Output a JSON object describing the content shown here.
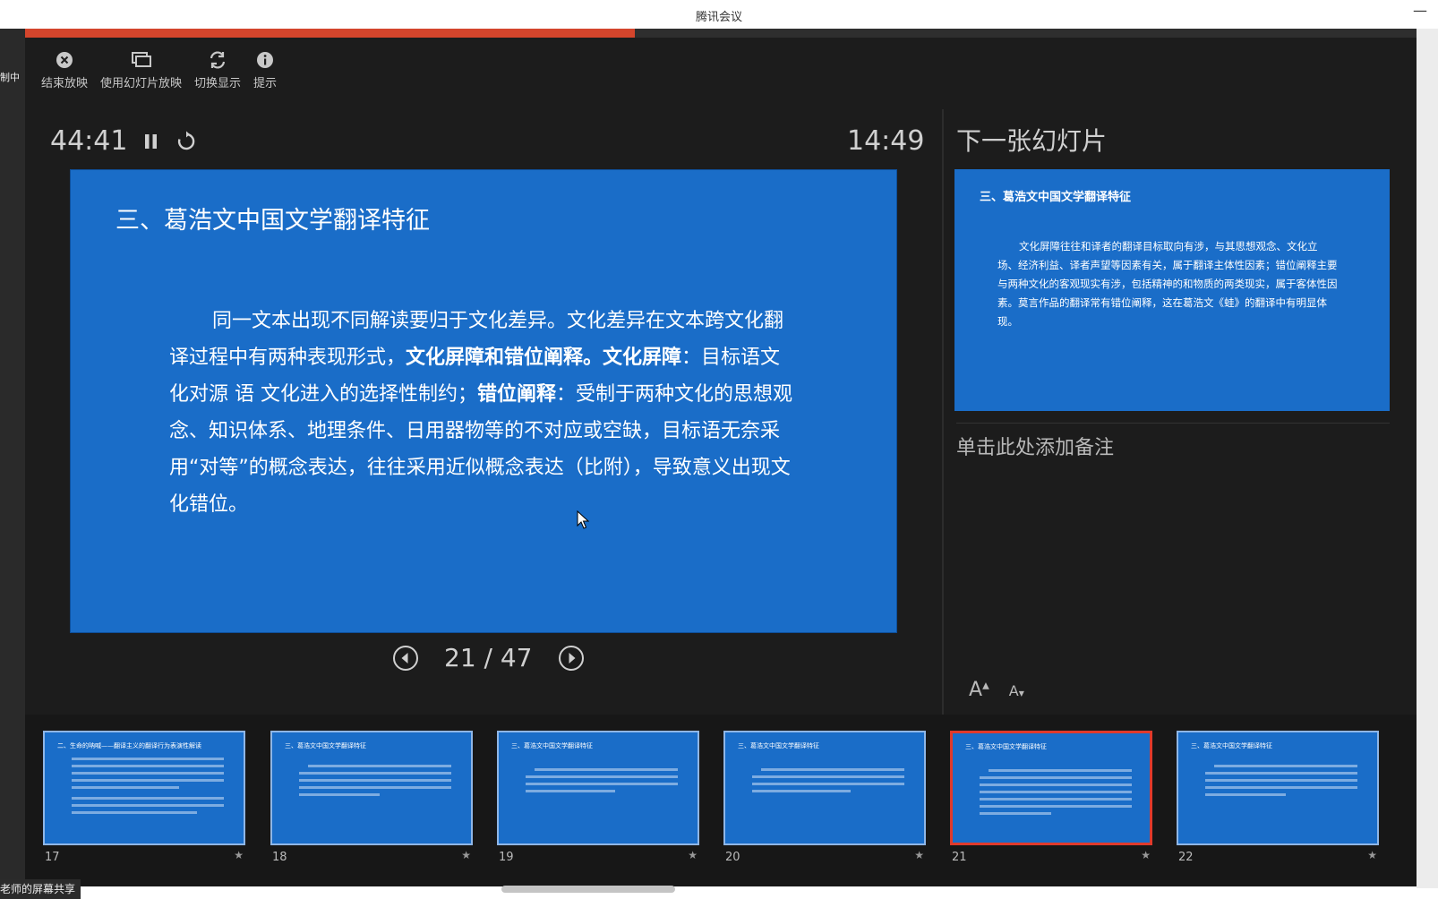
{
  "window": {
    "title": "腾讯会议",
    "minimize": "—"
  },
  "left_strip": {
    "text": "制中"
  },
  "progress": {
    "fraction": 0.438,
    "color": "#d4452c"
  },
  "toolbar": {
    "end": "结束放映",
    "use_slideshow": "使用幻灯片放映",
    "switch_display": "切换显示",
    "tips": "提示"
  },
  "timer": {
    "elapsed": "44:41",
    "clock": "14:49"
  },
  "current_slide": {
    "title": "三、葛浩文中国文学翻译特征",
    "body_a": "同一文本出现不同解读要归于文化差异。文化差异在文本跨文化翻译过程中有两种表现形式，",
    "body_b": "文化屏障和错位阐释。文化屏障",
    "body_c": "：目标语文化对源 语 文化进入的选择性制约；",
    "body_d": "错位阐释",
    "body_e": "：受制于两种文化的思想观念、知识体系、地理条件、日用器物等的不对应或空缺，目标语无奈采用“对等”的概念表达，往往采用近似概念表达（比附），导致意义出现文化错位。"
  },
  "navigation": {
    "counter": "21 / 47"
  },
  "next_slide": {
    "heading": "下一张幻灯片",
    "title": "三、葛浩文中国文学翻译特征",
    "body": "文化屏障往往和译者的翻译目标取向有涉，与其思想观念、文化立场、经济利益、译者声望等因素有关，属于翻译主体性因素；错位阐释主要与两种文化的客观现实有涉，包括精神的和物质的两类现实，属于客体性因素。莫言作品的翻译常有错位阐释，这在葛浩文《蛙》的翻译中有明显体现。"
  },
  "notes": {
    "placeholder": "单击此处添加备注"
  },
  "font_controls": {
    "increase": "A",
    "decrease": "A"
  },
  "thumbnails": [
    {
      "num": "17",
      "title": "二、生命的呐喊——翻译主义的翻译行为表演性解读"
    },
    {
      "num": "18",
      "title": "三、葛浩文中国文学翻译特征"
    },
    {
      "num": "19",
      "title": "三、葛浩文中国文学翻译特征"
    },
    {
      "num": "20",
      "title": "三、葛浩文中国文学翻译特征"
    },
    {
      "num": "21",
      "title": "三、葛浩文中国文学翻译特征"
    },
    {
      "num": "22",
      "title": "三、葛浩文中国文学翻译特征"
    }
  ],
  "share_label": "老师的屏幕共享"
}
